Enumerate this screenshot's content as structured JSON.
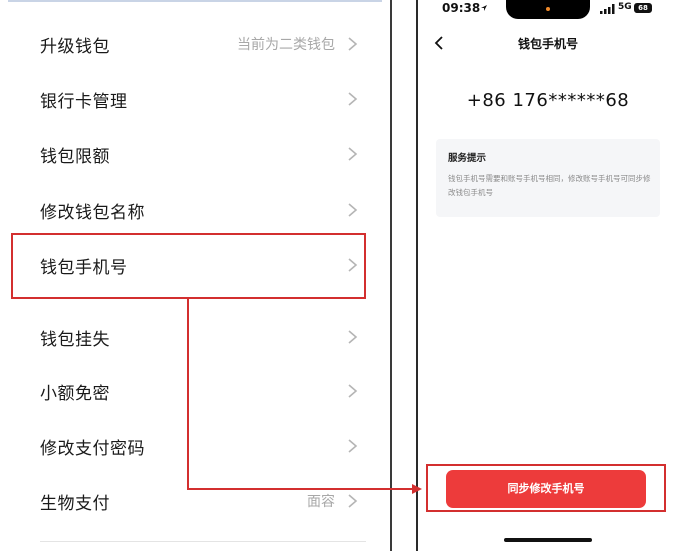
{
  "left_menu": {
    "items": [
      {
        "label": "升级钱包",
        "value": "当前为二类钱包"
      },
      {
        "label": "银行卡管理",
        "value": ""
      },
      {
        "label": "钱包限额",
        "value": ""
      },
      {
        "label": "修改钱包名称",
        "value": ""
      },
      {
        "label": "钱包手机号",
        "value": ""
      },
      {
        "label": "钱包挂失",
        "value": ""
      },
      {
        "label": "小额免密",
        "value": ""
      },
      {
        "label": "修改支付密码",
        "value": ""
      },
      {
        "label": "生物支付",
        "value": "面容"
      }
    ]
  },
  "status_bar": {
    "time": "09:38",
    "network": "5G",
    "battery": "68"
  },
  "phone_screen": {
    "title": "钱包手机号",
    "phone_number": "+86 176******68",
    "service_tip": {
      "title": "服务提示",
      "body": "钱包手机号需要和账号手机号相同，修改账号手机号可同步修改钱包手机号"
    },
    "sync_button_label": "同步修改手机号"
  },
  "colors": {
    "highlight": "#d32f2f",
    "button": "#ed3b3b",
    "card_bg": "#f5f6f8"
  },
  "icons": {
    "chevron": "chevron-right-icon",
    "back": "chevron-left-icon",
    "location": "location-arrow-icon",
    "signal": "signal-bars-icon"
  }
}
